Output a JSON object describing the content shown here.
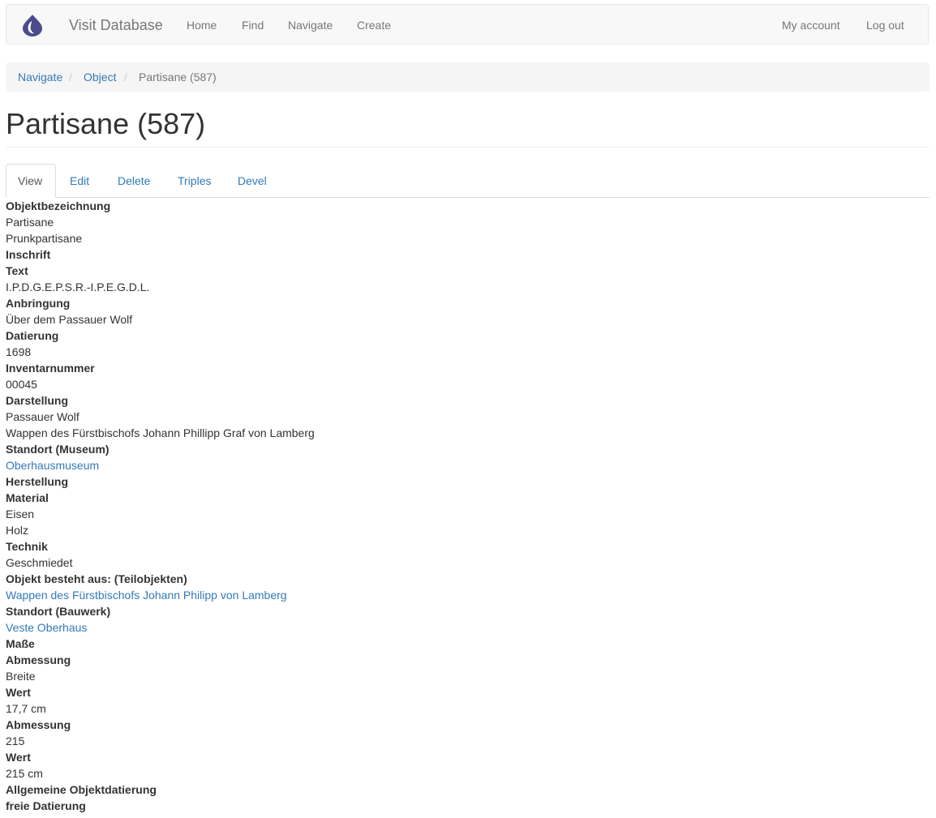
{
  "navbar": {
    "logo_icon": "drop-logo-icon",
    "logo_color": "#4c4b8c",
    "brand": "Visit Database",
    "items": [
      "Home",
      "Find",
      "Navigate",
      "Create"
    ],
    "right_items": [
      "My account",
      "Log out"
    ]
  },
  "breadcrumb": {
    "items": [
      "Navigate",
      "Object"
    ],
    "separator": "/",
    "active": "Partisane (587)"
  },
  "page": {
    "title": "Partisane (587)"
  },
  "tabs": {
    "items": [
      "View",
      "Edit",
      "Delete",
      "Triples",
      "Devel"
    ],
    "active": "View"
  },
  "fields": [
    {
      "type": "label",
      "text": "Objektbezeichnung"
    },
    {
      "type": "value",
      "text": "Partisane"
    },
    {
      "type": "value",
      "text": "Prunkpartisane"
    },
    {
      "type": "label",
      "text": "Inschrift"
    },
    {
      "type": "label",
      "text": "Text"
    },
    {
      "type": "value",
      "text": "I.P.D.G.E.P.S.R.-I.P.E.G.D.L."
    },
    {
      "type": "label",
      "text": "Anbringung"
    },
    {
      "type": "value",
      "text": "Über dem Passauer Wolf"
    },
    {
      "type": "label",
      "text": "Datierung"
    },
    {
      "type": "value",
      "text": "1698"
    },
    {
      "type": "label",
      "text": "Inventarnummer"
    },
    {
      "type": "value",
      "text": "00045"
    },
    {
      "type": "label",
      "text": "Darstellung"
    },
    {
      "type": "value",
      "text": "Passauer Wolf"
    },
    {
      "type": "value",
      "text": "Wappen des Fürstbischofs Johann Phillipp Graf von Lamberg"
    },
    {
      "type": "label",
      "text": "Standort (Museum)"
    },
    {
      "type": "link",
      "text": "Oberhausmuseum"
    },
    {
      "type": "label",
      "text": "Herstellung"
    },
    {
      "type": "label",
      "text": "Material"
    },
    {
      "type": "value",
      "text": "Eisen"
    },
    {
      "type": "value",
      "text": "Holz"
    },
    {
      "type": "label",
      "text": "Technik"
    },
    {
      "type": "value",
      "text": "Geschmiedet"
    },
    {
      "type": "label",
      "text": "Objekt besteht aus: (Teilobjekten)"
    },
    {
      "type": "link",
      "text": "Wappen des Fürstbischofs Johann Philipp von Lamberg"
    },
    {
      "type": "label",
      "text": "Standort (Bauwerk)"
    },
    {
      "type": "link",
      "text": "Veste Oberhaus"
    },
    {
      "type": "label",
      "text": "Maße"
    },
    {
      "type": "label",
      "text": "Abmessung"
    },
    {
      "type": "value",
      "text": "Breite"
    },
    {
      "type": "label",
      "text": "Wert"
    },
    {
      "type": "value",
      "text": "17,7 cm"
    },
    {
      "type": "label",
      "text": "Abmessung"
    },
    {
      "type": "value",
      "text": "215"
    },
    {
      "type": "label",
      "text": "Wert"
    },
    {
      "type": "value",
      "text": "215 cm"
    },
    {
      "type": "label",
      "text": "Allgemeine Objektdatierung"
    },
    {
      "type": "label",
      "text": "freie Datierung"
    }
  ]
}
